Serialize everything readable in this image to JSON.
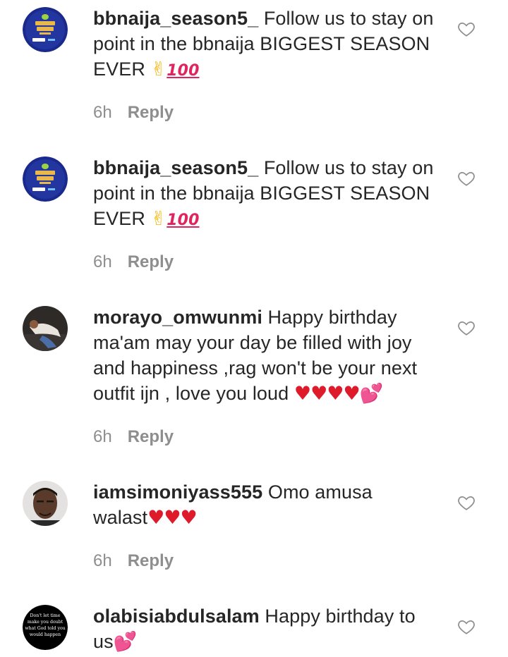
{
  "comments": [
    {
      "username": "bbnaija_season5_",
      "text": " Follow us to stay on point in the bbnaija BIGGEST SEASON EVER ",
      "emoji_peace": "✌",
      "emoji_100": "100",
      "time": "6h",
      "reply": "Reply",
      "avatar_icon": "bbnaija-logo-icon"
    },
    {
      "username": "bbnaija_season5_",
      "text": " Follow us to stay on point in the bbnaija BIGGEST SEASON EVER ",
      "emoji_peace": "✌",
      "emoji_100": "100",
      "time": "6h",
      "reply": "Reply",
      "avatar_icon": "bbnaija-logo-icon"
    },
    {
      "username": "morayo_omwunmi",
      "text": " Happy birthday ma'am may your day be filled with joy and happiness ,rag won't be your next outfit ijn , love you loud ",
      "emoji_hearts": "♥♥♥♥",
      "emoji_sparkle": "💕",
      "time": "6h",
      "reply": "Reply",
      "avatar_icon": "user-photo-icon"
    },
    {
      "username": "iamsimoniyass555",
      "text": " Omo amusa walast",
      "emoji_hearts": "♥♥♥",
      "time": "6h",
      "reply": "Reply",
      "avatar_icon": "user-photo-icon"
    },
    {
      "username": "olabisiabdulsalam",
      "text": " Happy birthday to us",
      "emoji_sparkle": "💕",
      "avatar_text": "Don't let time make you doubt what God told you would happen",
      "avatar_icon": "quote-avatar-icon"
    }
  ],
  "colors": {
    "text": "#262626",
    "meta": "#8e8e8e",
    "heart": "#dd1b2b"
  }
}
